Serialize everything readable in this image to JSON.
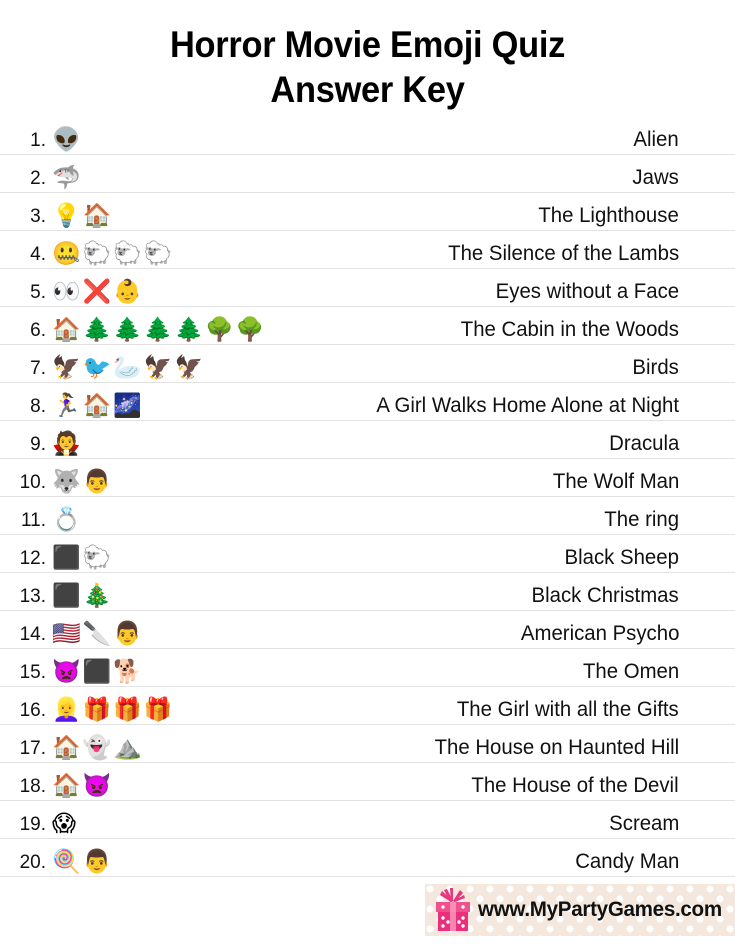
{
  "page": {
    "title_line_1": "Horror Movie Emoji Quiz",
    "title_line_2": "Answer Key"
  },
  "quiz": {
    "rows": [
      {
        "number": "1.",
        "emoji": "👽",
        "answer": "Alien"
      },
      {
        "number": "2.",
        "emoji": "🦈",
        "answer": "Jaws"
      },
      {
        "number": "3.",
        "emoji": "💡🏠",
        "answer": "The Lighthouse"
      },
      {
        "number": "4.",
        "emoji": "🤐🐑🐑🐑",
        "answer": "The Silence of the Lambs"
      },
      {
        "number": "5.",
        "emoji": "👀❌👶",
        "answer": "Eyes without a Face"
      },
      {
        "number": "6.",
        "emoji": "🏠🌲🌲🌲🌲🌳🌳",
        "answer": "The Cabin in the Woods"
      },
      {
        "number": "7.",
        "emoji": "🦅🐦🦢🦅🦅",
        "answer": "Birds"
      },
      {
        "number": "8.",
        "emoji": "🏃‍♀️🏠🌌",
        "answer": "A Girl Walks Home Alone at Night"
      },
      {
        "number": "9.",
        "emoji": "🧛",
        "answer": "Dracula"
      },
      {
        "number": "10.",
        "emoji": "🐺👨",
        "answer": "The Wolf Man"
      },
      {
        "number": "11.",
        "emoji": "💍",
        "answer": "The ring"
      },
      {
        "number": "12.",
        "emoji": "⬛🐑",
        "answer": "Black Sheep"
      },
      {
        "number": "13.",
        "emoji": "⬛🎄",
        "answer": "Black Christmas"
      },
      {
        "number": "14.",
        "emoji": "🇺🇸🔪👨",
        "answer": "American Psycho"
      },
      {
        "number": "15.",
        "emoji": "👿⬛🐕",
        "answer": "The Omen"
      },
      {
        "number": "16.",
        "emoji": "👱‍♀️🎁🎁🎁",
        "answer": "The Girl with all the Gifts"
      },
      {
        "number": "17.",
        "emoji": "🏠👻⛰️",
        "answer": "The House on Haunted Hill"
      },
      {
        "number": "18.",
        "emoji": "🏠👿",
        "answer": "The House of the Devil"
      },
      {
        "number": "19.",
        "emoji": "😱",
        "answer": "Scream"
      },
      {
        "number": "20.",
        "emoji": "🍭👨",
        "answer": "Candy Man"
      }
    ]
  },
  "footer": {
    "url": "www.MyPartyGames.com",
    "icon": "gift-box-icon",
    "background_color": "#f4e7dd",
    "gift_color": "#ec407a"
  }
}
